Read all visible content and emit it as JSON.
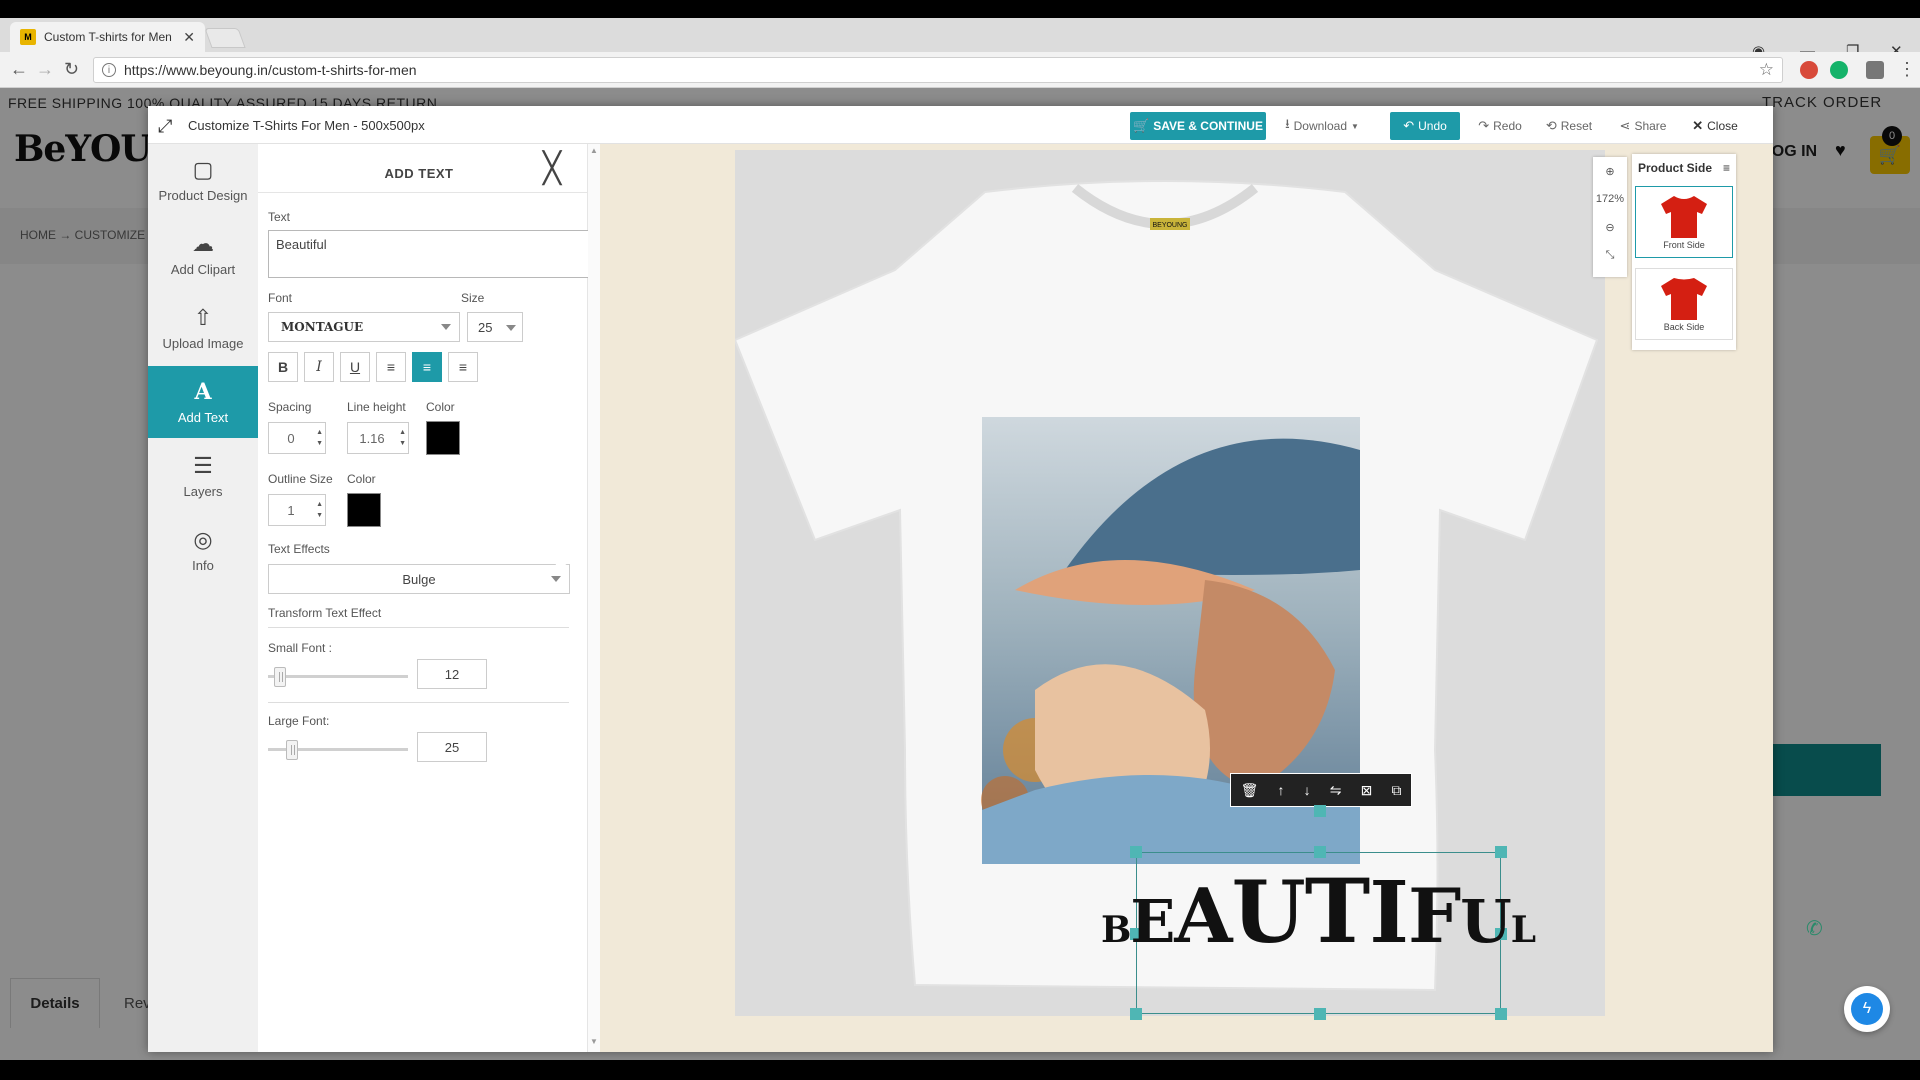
{
  "browser": {
    "tab_title": "Custom T-shirts for Men",
    "tab_close": "✕",
    "url": "https://www.beyoung.in/custom-t-shirts-for-men",
    "window_controls": [
      "—",
      "❐",
      "✕"
    ]
  },
  "site": {
    "promo": "FREE SHIPPING   100% QUALITY ASSURED   15 DAYS RETURN",
    "track_order": "TRACK ORDER",
    "logo": "BeYOUng",
    "login": "LOG IN",
    "cart_count": "0",
    "breadcrumb": "HOME  →  CUSTOMIZE",
    "details_tab": "Details",
    "reviews_tab": "Rev"
  },
  "modal": {
    "title": "Customize T-Shirts For Men - 500x500px",
    "toolbar": {
      "save": "SAVE & CONTINUE",
      "download": "Download",
      "undo": "Undo",
      "redo": "Redo",
      "reset": "Reset",
      "share": "Share",
      "close": "Close"
    },
    "sidebar": [
      {
        "label": "Product Design",
        "icon": "▢"
      },
      {
        "label": "Add Clipart",
        "icon": "☁"
      },
      {
        "label": "Upload Image",
        "icon": "⇧"
      },
      {
        "label": "Add Text",
        "icon": "A"
      },
      {
        "label": "Layers",
        "icon": "☰"
      },
      {
        "label": "Info",
        "icon": "◎"
      }
    ],
    "active_sidebar": "Add Text",
    "panel": {
      "title": "ADD TEXT",
      "text_label": "Text",
      "text_value": "Beautiful",
      "font_label": "Font",
      "font_value": "MONTAGUE",
      "size_label": "Size",
      "size_value": "25",
      "spacing_label": "Spacing",
      "spacing_value": "0",
      "line_height_label": "Line height",
      "line_height_value": "1.16",
      "color_label": "Color",
      "text_color": "#000000",
      "outline_size_label": "Outline Size",
      "outline_size_value": "1",
      "outline_color_label": "Color",
      "outline_color": "#000000",
      "text_effects_label": "Text Effects",
      "text_effects_value": "Bulge",
      "transform_label": "Transform Text Effect",
      "small_font_label": "Small Font :",
      "small_font_value": "12",
      "large_font_label": "Large Font:",
      "large_font_value": "25",
      "alignment": "center"
    },
    "zoom": {
      "level": "172%"
    },
    "product_side": {
      "title": "Product Side",
      "front": "Front Side",
      "back": "Back Side",
      "selected": "Front Side",
      "tshirt_color": "#d41f12"
    },
    "design": {
      "text": "BEAUTIFUL",
      "tshirt_label": "BEYOUNG"
    }
  },
  "colors": {
    "accent": "#1e9aa8",
    "cart": "#f7c600"
  }
}
